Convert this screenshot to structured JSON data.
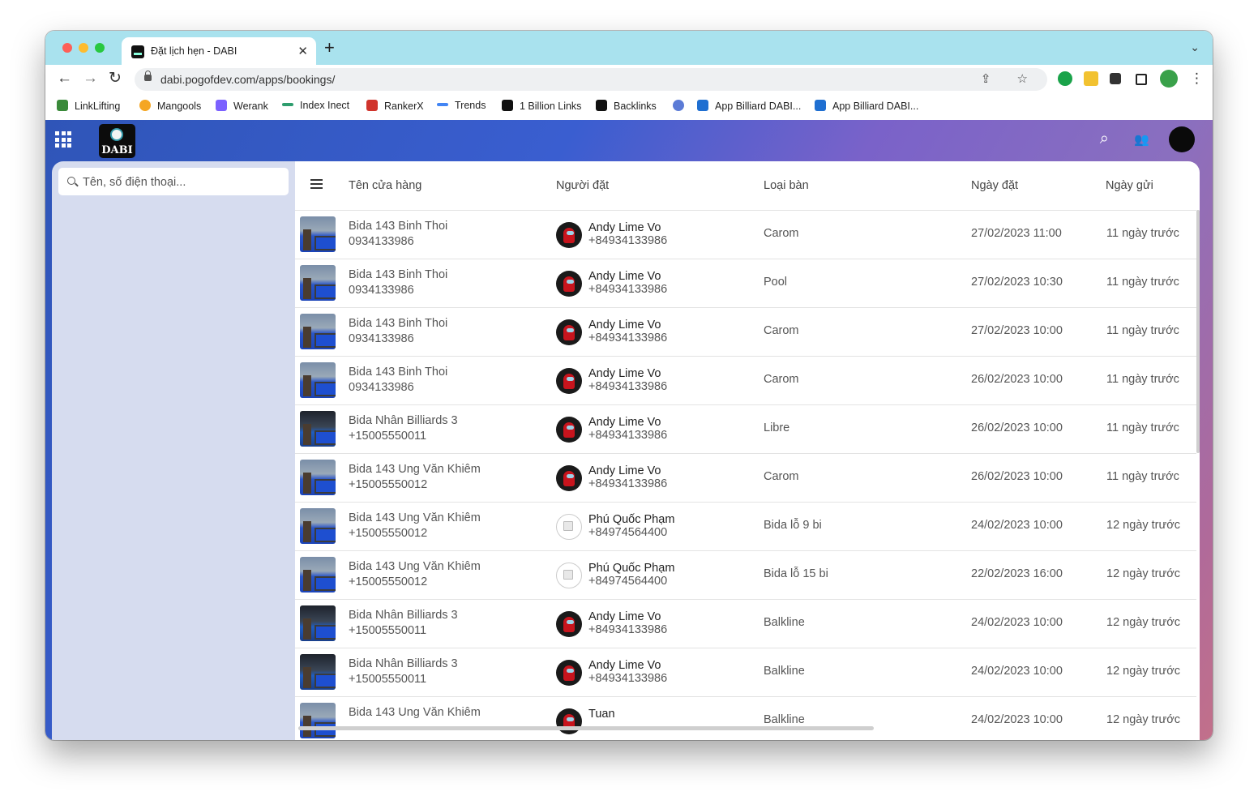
{
  "browser": {
    "tab_title": "Đặt lịch hẹn - DABI",
    "tab_close": "✕",
    "new_tab": "+",
    "tabs_menu": "⌄",
    "url": "dabi.pogofdev.com/apps/bookings/",
    "back": "←",
    "forward": "→",
    "reload": "↻",
    "omnibox_icons": "⇪ ☆",
    "more": "⋮"
  },
  "bookmarks": [
    {
      "label": "LinkLifting",
      "color": "#3a8a3a"
    },
    {
      "label": "Mangools",
      "color": "#f5a623"
    },
    {
      "label": "Werank",
      "color": "#7b61ff"
    },
    {
      "label": "Index Inect",
      "color": "#2e9d6e"
    },
    {
      "label": "RankerX",
      "color": "#d0342c"
    },
    {
      "label": "Trends",
      "color": "#4285f4"
    },
    {
      "label": "1 Billion Links",
      "color": "#111111"
    },
    {
      "label": "Backlinks",
      "color": "#111111"
    },
    {
      "label": "",
      "color": "#5b7bd6"
    },
    {
      "label": "App Billiard DABI...",
      "color": "#1f6fd1"
    },
    {
      "label": "App Billiard DABI...",
      "color": "#1f6fd1"
    }
  ],
  "app": {
    "logo_text": "DABI",
    "search_icon": "⌕",
    "contacts_icon": "👥"
  },
  "search": {
    "placeholder": "Tên, số điện thoại..."
  },
  "table": {
    "headers": {
      "store": "Tên cửa hàng",
      "person": "Người đặt",
      "table_type": "Loại bàn",
      "booked_at": "Ngày đặt",
      "sent": "Ngày gửi"
    },
    "rows": [
      {
        "store": "Bida 143 Binh Thoi",
        "store_phone": "0934133986",
        "person": "Andy Lime Vo",
        "person_phone": "+84934133986",
        "table_type": "Carom",
        "booked_at": "27/02/2023 11:00",
        "sent": "11 ngày trước"
      },
      {
        "store": "Bida 143 Binh Thoi",
        "store_phone": "0934133986",
        "person": "Andy Lime Vo",
        "person_phone": "+84934133986",
        "table_type": "Pool",
        "booked_at": "27/02/2023 10:30",
        "sent": "11 ngày trước"
      },
      {
        "store": "Bida 143 Binh Thoi",
        "store_phone": "0934133986",
        "person": "Andy Lime Vo",
        "person_phone": "+84934133986",
        "table_type": "Carom",
        "booked_at": "27/02/2023 10:00",
        "sent": "11 ngày trước"
      },
      {
        "store": "Bida 143 Binh Thoi",
        "store_phone": "0934133986",
        "person": "Andy Lime Vo",
        "person_phone": "+84934133986",
        "table_type": "Carom",
        "booked_at": "26/02/2023 10:00",
        "sent": "11 ngày trước"
      },
      {
        "store": "Bida Nhân Billiards 3",
        "store_phone": "+15005550011",
        "person": "Andy Lime Vo",
        "person_phone": "+84934133986",
        "table_type": "Libre",
        "booked_at": "26/02/2023 10:00",
        "sent": "11 ngày trước"
      },
      {
        "store": "Bida 143 Ung Văn Khiêm",
        "store_phone": "+15005550012",
        "person": "Andy Lime Vo",
        "person_phone": "+84934133986",
        "table_type": "Carom",
        "booked_at": "26/02/2023 10:00",
        "sent": "11 ngày trước"
      },
      {
        "store": "Bida 143 Ung Văn Khiêm",
        "store_phone": "+15005550012",
        "person": "Phú Quốc Phạm",
        "person_phone": "+84974564400",
        "table_type": "Bida lỗ 9 bi",
        "booked_at": "24/02/2023 10:00",
        "sent": "12 ngày trước"
      },
      {
        "store": "Bida 143 Ung Văn Khiêm",
        "store_phone": "+15005550012",
        "person": "Phú Quốc Phạm",
        "person_phone": "+84974564400",
        "table_type": "Bida lỗ 15 bi",
        "booked_at": "22/02/2023 16:00",
        "sent": "12 ngày trước"
      },
      {
        "store": "Bida Nhân Billiards 3",
        "store_phone": "+15005550011",
        "person": "Andy Lime Vo",
        "person_phone": "+84934133986",
        "table_type": "Balkline",
        "booked_at": "24/02/2023 10:00",
        "sent": "12 ngày trước"
      },
      {
        "store": "Bida Nhân Billiards 3",
        "store_phone": "+15005550011",
        "person": "Andy Lime Vo",
        "person_phone": "+84934133986",
        "table_type": "Balkline",
        "booked_at": "24/02/2023 10:00",
        "sent": "12 ngày trước"
      },
      {
        "store": "Bida 143 Ung Văn Khiêm",
        "store_phone": "",
        "person": "Tuan",
        "person_phone": "",
        "table_type": "Balkline",
        "booked_at": "24/02/2023 10:00",
        "sent": "12 ngày trước"
      }
    ]
  }
}
